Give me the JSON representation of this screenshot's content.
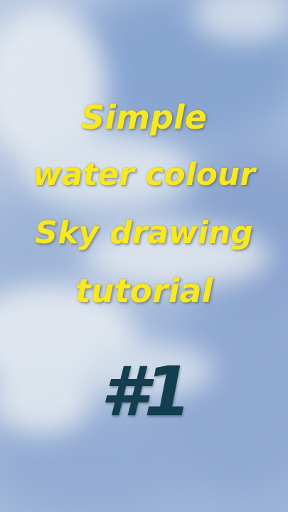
{
  "title_lines": [
    "Simple",
    "water colour",
    "Sky drawing",
    "tutorial"
  ],
  "episode": "#1",
  "colors": {
    "title_text": "#f7e821",
    "episode_text": "#133e50",
    "sky_light": "#e4ebf3",
    "sky_mid": "#a9bfdc",
    "sky_deep": "#7f9ccc"
  }
}
